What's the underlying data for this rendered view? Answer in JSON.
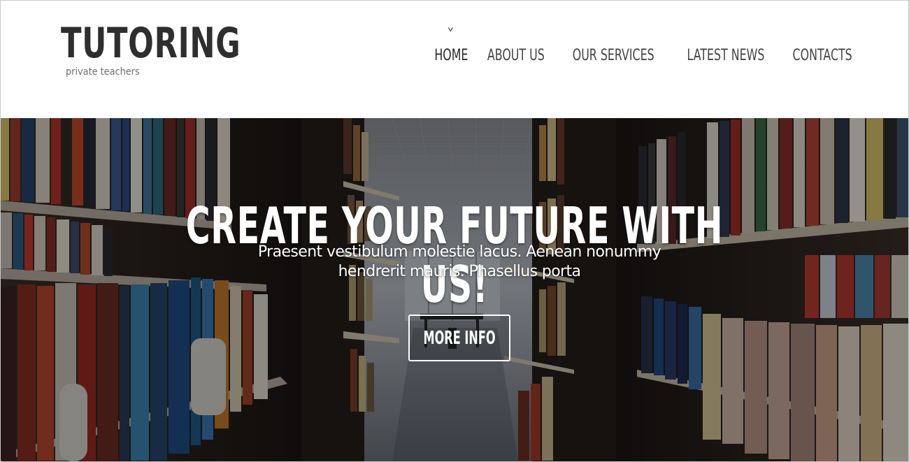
{
  "brand": {
    "title": "TUTORING",
    "subtitle": "private teachers"
  },
  "nav": {
    "items": [
      {
        "label": "HOME",
        "active": true
      },
      {
        "label": "ABOUT US",
        "active": false
      },
      {
        "label": "OUR SERVICES",
        "active": false
      },
      {
        "label": "LATEST NEWS",
        "active": false
      },
      {
        "label": "CONTACTS",
        "active": false
      }
    ],
    "active_indicator_icon": "chevron-down-icon"
  },
  "hero": {
    "title": "CREATE YOUR FUTURE WITH US!",
    "text": "Praesent vestibulum molestie lacus. Aenean nonummy hendrerit mauris. Phasellus porta",
    "button_label": "MORE INFO",
    "background": "library-bookshelves-photo"
  },
  "colors": {
    "text_dark": "#2e2e2e",
    "nav_text": "#444444",
    "hero_text": "#ffffff"
  }
}
